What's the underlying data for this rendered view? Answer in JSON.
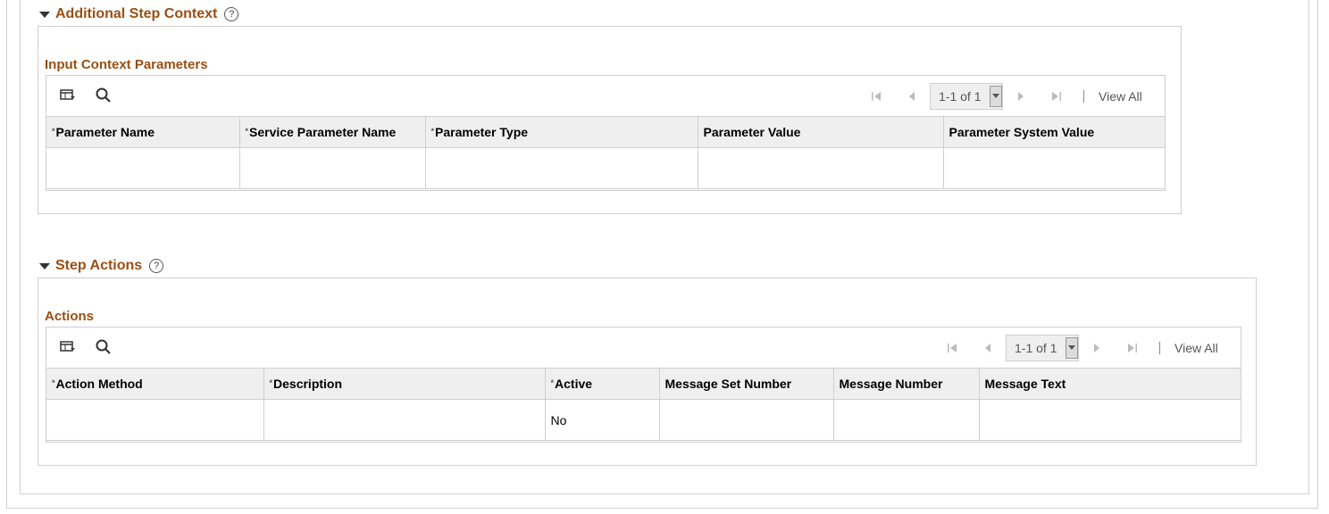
{
  "section1": {
    "title": "Additional Step Context",
    "grid": {
      "title": "Input Context Parameters",
      "pager": "1-1 of 1",
      "view_all": "View All",
      "columns": [
        {
          "label": "Parameter Name",
          "required": true
        },
        {
          "label": "Service Parameter Name",
          "required": true
        },
        {
          "label": "Parameter Type",
          "required": true
        },
        {
          "label": "Parameter Value",
          "required": false
        },
        {
          "label": "Parameter System Value",
          "required": false
        }
      ],
      "rows": [
        [
          "",
          "",
          "",
          "",
          ""
        ]
      ]
    }
  },
  "section2": {
    "title": "Step Actions",
    "grid": {
      "title": "Actions",
      "pager": "1-1 of 1",
      "view_all": "View All",
      "columns": [
        {
          "label": "Action Method",
          "required": true
        },
        {
          "label": "Description",
          "required": true
        },
        {
          "label": "Active",
          "required": true
        },
        {
          "label": "Message Set Number",
          "required": false
        },
        {
          "label": "Message Number",
          "required": false
        },
        {
          "label": "Message Text",
          "required": false
        }
      ],
      "rows": [
        [
          "",
          "",
          "No",
          "",
          "",
          ""
        ]
      ]
    }
  },
  "icons": {
    "collapse": "triangle-down-icon",
    "help": "help-circle-icon",
    "personalize": "grid-personalize-icon",
    "find": "search-icon",
    "first": "first-page-icon",
    "prev": "previous-page-icon",
    "next": "next-page-icon",
    "last": "last-page-icon",
    "dropdown": "chevron-down-icon"
  },
  "colors": {
    "section_title": "#9a4f12",
    "header_bg": "#efefef",
    "border": "#cfcfcf"
  }
}
